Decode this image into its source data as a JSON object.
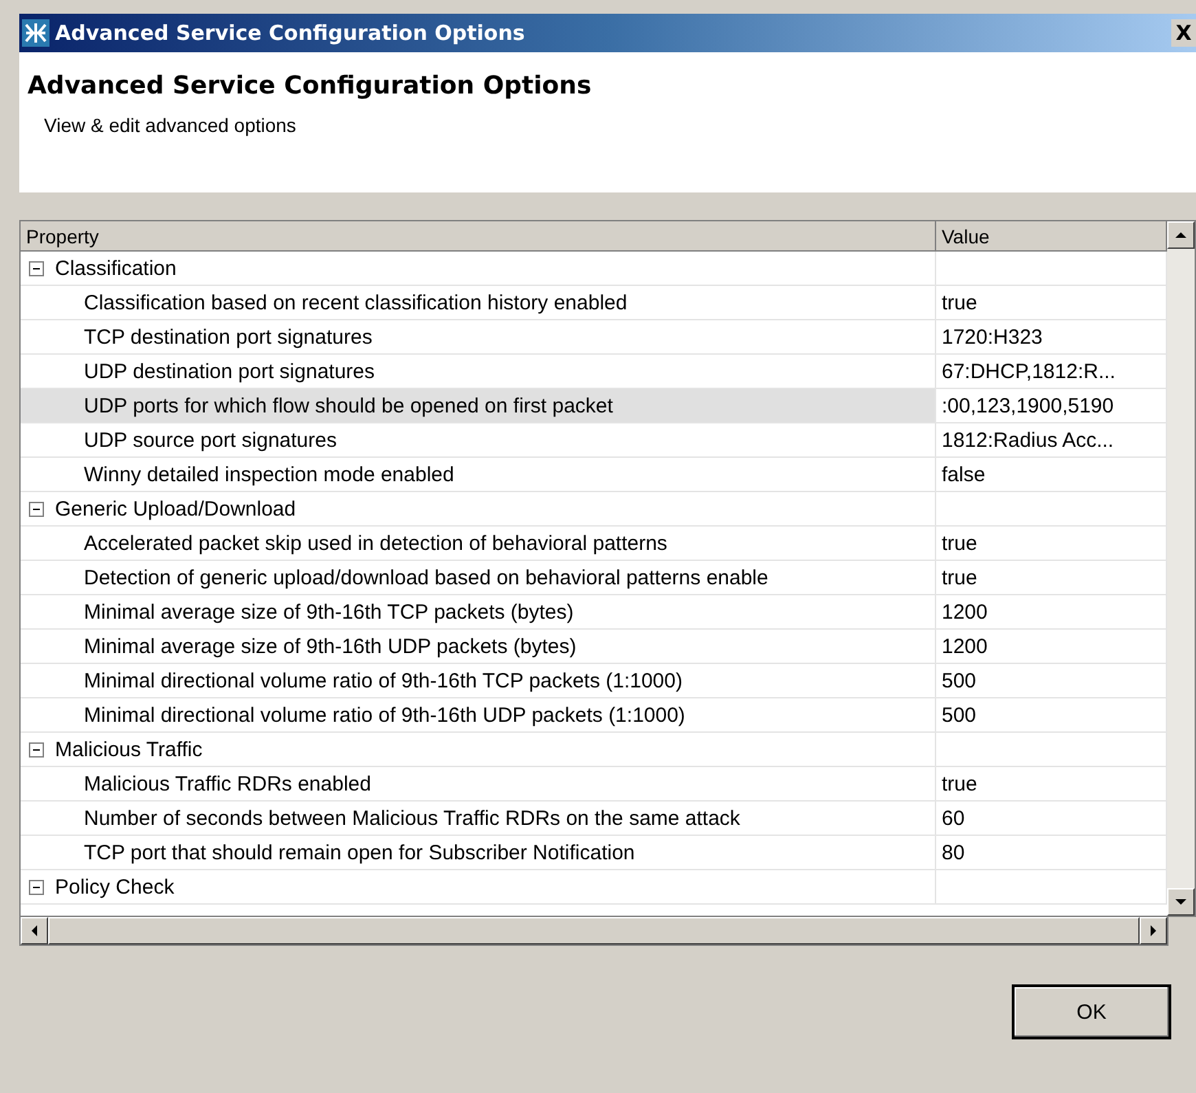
{
  "window": {
    "title": "Advanced Service Configuration Options",
    "close": "X"
  },
  "header": {
    "title": "Advanced Service Configuration Options",
    "subtitle": "View & edit advanced options"
  },
  "table": {
    "columns": [
      "Property",
      "Value"
    ],
    "rows": [
      {
        "label": "Classification",
        "expanded": true,
        "children": [
          {
            "property": "Classification based on recent classification history enabled",
            "value": "true",
            "selected": false
          },
          {
            "property": "TCP destination port signatures",
            "value": "1720:H323",
            "selected": false
          },
          {
            "property": "UDP destination port signatures",
            "value": "67:DHCP,1812:R...",
            "selected": false
          },
          {
            "property": "UDP ports for which flow should be opened on first packet",
            "value": ":00,123,1900,5190",
            "selected": true
          },
          {
            "property": "UDP source port signatures",
            "value": "1812:Radius Acc...",
            "selected": false
          },
          {
            "property": "Winny detailed inspection mode enabled",
            "value": "false",
            "selected": false
          }
        ]
      },
      {
        "label": "Generic Upload/Download",
        "expanded": true,
        "children": [
          {
            "property": "Accelerated packet skip used in detection of behavioral patterns",
            "value": "true",
            "selected": false
          },
          {
            "property": "Detection of generic upload/download based on behavioral patterns enable",
            "value": "true",
            "selected": false
          },
          {
            "property": "Minimal average size of 9th-16th TCP packets (bytes)",
            "value": "1200",
            "selected": false
          },
          {
            "property": "Minimal average size of 9th-16th UDP packets (bytes)",
            "value": "1200",
            "selected": false
          },
          {
            "property": "Minimal directional volume ratio of 9th-16th TCP packets (1:1000)",
            "value": "500",
            "selected": false
          },
          {
            "property": "Minimal directional volume ratio of 9th-16th UDP packets (1:1000)",
            "value": "500",
            "selected": false
          }
        ]
      },
      {
        "label": "Malicious Traffic",
        "expanded": true,
        "children": [
          {
            "property": "Malicious Traffic RDRs enabled",
            "value": "true",
            "selected": false
          },
          {
            "property": "Number of seconds between Malicious Traffic RDRs on the same attack",
            "value": "60",
            "selected": false
          },
          {
            "property": "TCP port that should remain open for Subscriber Notification",
            "value": "80",
            "selected": false
          }
        ]
      },
      {
        "label": "Policy Check",
        "expanded": true,
        "children": []
      }
    ]
  },
  "buttons": [
    "OK"
  ]
}
